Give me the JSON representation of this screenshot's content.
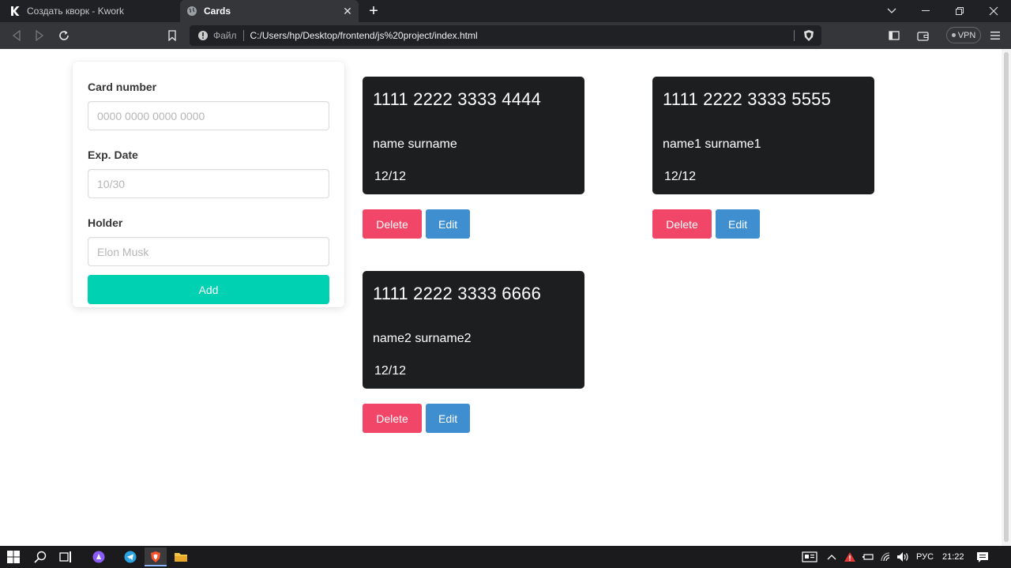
{
  "browser": {
    "tabs": [
      {
        "title": "Создать кворк - Kwork",
        "active": false,
        "icon": "kwork-logo-icon"
      },
      {
        "title": "Cards",
        "active": true,
        "icon": "globe-icon"
      }
    ],
    "address": {
      "scheme_label": "Файл",
      "url": "C:/Users/hp/Desktop/frontend/js%20project/index.html"
    },
    "vpn_label": "VPN"
  },
  "form": {
    "card_number": {
      "label": "Card number",
      "placeholder": "0000 0000 0000 0000",
      "value": ""
    },
    "exp_date": {
      "label": "Exp. Date",
      "placeholder": "10/30",
      "value": ""
    },
    "holder": {
      "label": "Holder",
      "placeholder": "Elon Musk",
      "value": ""
    },
    "add_label": "Add",
    "add_color": "#00d1b2"
  },
  "cards": [
    {
      "number": "1111 2222 3333 4444",
      "holder": "name surname",
      "date": "12/12",
      "delete_label": "Delete",
      "edit_label": "Edit"
    },
    {
      "number": "1111 2222 3333 5555",
      "holder": "name1 surname1",
      "date": "12/12",
      "delete_label": "Delete",
      "edit_label": "Edit"
    },
    {
      "number": "1111 2222 3333 6666",
      "holder": "name2 surname2",
      "date": "12/12",
      "delete_label": "Delete",
      "edit_label": "Edit"
    }
  ],
  "colors": {
    "card_bg": "#1d1e20",
    "delete": "#f14668",
    "edit": "#3e8ed0"
  },
  "taskbar": {
    "language": "РУС",
    "time": "21:22"
  }
}
